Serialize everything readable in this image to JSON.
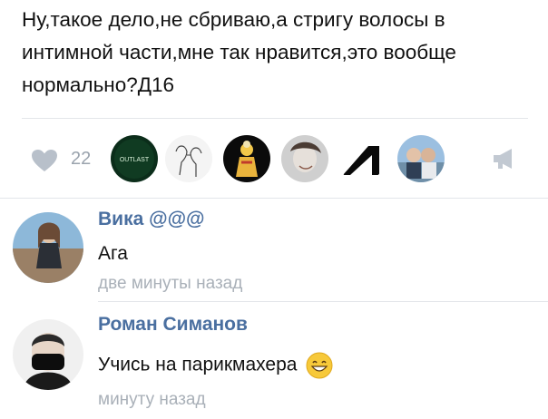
{
  "post": {
    "text": "Ну,такое дело,не сбриваю,а стригу волосы в интимной части,мне так нравится,это вообще нормально?Д16"
  },
  "likes": {
    "count": "22",
    "likers": [
      {
        "name": "outlast-avatar",
        "logo_text": "OUTLAST",
        "color": "#0b2d1a"
      },
      {
        "name": "sketch-couple-avatar",
        "color": "#f2f2f2"
      },
      {
        "name": "illustrated-figure-avatar",
        "color": "#0b0b0b"
      },
      {
        "name": "girl-sketch-avatar",
        "color": "#d9d9d9"
      },
      {
        "name": "angle-logo-avatar",
        "color": "#ffffff"
      },
      {
        "name": "couple-photo-avatar",
        "color": "#8fb3d6"
      }
    ],
    "colors": {
      "icon": "#b8c0ca",
      "count": "#9aa3ad"
    }
  },
  "comments": [
    {
      "author": "Вика @@@",
      "text": "Ага",
      "time": "две минуты назад"
    },
    {
      "author": "Роман Симанов",
      "text": "Учись на парикмахера",
      "emoji": "smiling-face-emoji",
      "time": "минуту назад"
    }
  ],
  "colors": {
    "name": "#4a6fa0",
    "time": "#a9b0b8",
    "divider": "#e3e6ea"
  }
}
